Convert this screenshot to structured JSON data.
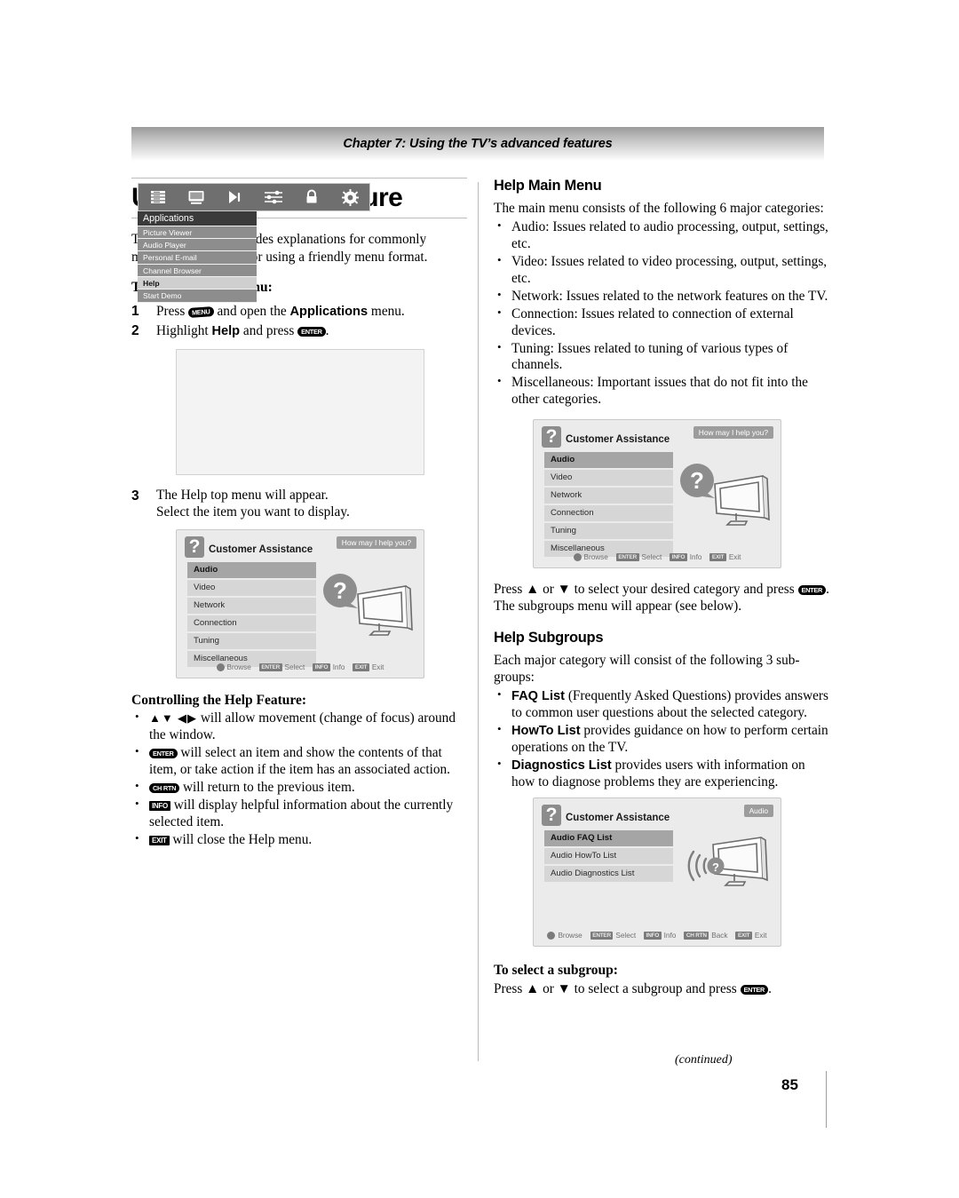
{
  "header": {
    "chapter": "Chapter 7: Using the TV’s advanced features"
  },
  "left_column": {
    "title": "Using the Help feature",
    "intro": "The Help feature provides explanations for commonly misunderstood behavior using a friendly menu format.",
    "open_help_heading": "To open the Help menu:",
    "steps": [
      {
        "num": "1",
        "before": "Press",
        "key": "MENU",
        "middle": "and open the",
        "bold": "Applications",
        "after": "menu."
      },
      {
        "num": "2",
        "before": "Highlight",
        "bold": "Help",
        "middle": "and press",
        "key": "ENTER",
        "after": "."
      },
      {
        "num": "3",
        "line1": "The Help top menu will appear.",
        "line2": "Select the item you want to display."
      }
    ],
    "apps_shot": {
      "icons": [
        "list-icon",
        "monitor-icon",
        "play-sound-icon",
        "sliders-icon",
        "lock-icon",
        "gear-icon"
      ],
      "menu_header": "Applications",
      "items": [
        {
          "label": "Picture Viewer",
          "selected": false
        },
        {
          "label": "Audio Player",
          "selected": false
        },
        {
          "label": "Personal E-mail",
          "selected": false
        },
        {
          "label": "Channel Browser",
          "selected": false
        },
        {
          "label": "Help",
          "selected": true
        },
        {
          "label": "Start Demo",
          "selected": false
        }
      ]
    },
    "ca_shot": {
      "title": "Customer Assistance",
      "pill": "How may I help you?",
      "items": [
        {
          "label": "Audio",
          "selected": true
        },
        {
          "label": "Video",
          "selected": false
        },
        {
          "label": "Network",
          "selected": false
        },
        {
          "label": "Connection",
          "selected": false
        },
        {
          "label": "Tuning",
          "selected": false
        },
        {
          "label": "Miscellaneous",
          "selected": false
        }
      ],
      "footer": [
        {
          "key": "",
          "icon": "dpad-icon",
          "label": "Browse"
        },
        {
          "key": "ENTER",
          "label": "Select"
        },
        {
          "key": "INFO",
          "label": "Info"
        },
        {
          "key": "EXIT",
          "label": "Exit"
        }
      ]
    },
    "controlling_heading": "Controlling the Help Feature:",
    "controlling_bullets": [
      {
        "glyph": "▲▼ ◀▶",
        "text": "will allow movement (change of focus) around the window."
      },
      {
        "key": "ENTER",
        "round": true,
        "text": "will select an item and show the contents of that item, or take action if the item has an associated action."
      },
      {
        "key": "CH RTN",
        "round": true,
        "text": "will return to the previous item."
      },
      {
        "key": "INFO",
        "round": false,
        "text": "will display helpful information about the currently selected item."
      },
      {
        "key": "EXIT",
        "round": false,
        "text": "will close the Help menu."
      }
    ]
  },
  "right_column": {
    "main_menu_heading": "Help Main Menu",
    "main_menu_intro": "The main menu consists of the following 6 major categories:",
    "main_menu_bullets": [
      "Audio: Issues related to audio processing, output, settings, etc.",
      "Video: Issues related to video processing, output, settings, etc.",
      "Network: Issues related to the network features on the TV.",
      "Connection: Issues related to connection of external devices.",
      "Tuning: Issues related to tuning of various types of channels.",
      "Miscellaneous: Important issues that do not fit into the other categories."
    ],
    "ca_shot": {
      "title": "Customer Assistance",
      "pill": "How may I help you?",
      "items": [
        {
          "label": "Audio",
          "selected": true
        },
        {
          "label": "Video",
          "selected": false
        },
        {
          "label": "Network",
          "selected": false
        },
        {
          "label": "Connection",
          "selected": false
        },
        {
          "label": "Tuning",
          "selected": false
        },
        {
          "label": "Miscellaneous",
          "selected": false
        }
      ],
      "footer": [
        {
          "icon": "dpad-icon",
          "label": "Browse"
        },
        {
          "key": "ENTER",
          "label": "Select"
        },
        {
          "key": "INFO",
          "label": "Info"
        },
        {
          "key": "EXIT",
          "label": "Exit"
        }
      ]
    },
    "press_para_1": "Press ▲ or ▼ to select your desired category and press",
    "press_para_1_key": "ENTER",
    "press_para_2": "The subgroups menu will appear (see below).",
    "subgroups_heading": "Help Subgroups",
    "subgroups_intro": "Each major category will consist of the following 3 sub-groups:",
    "subgroups_bullets": [
      {
        "bold": "FAQ List",
        "text": "(Frequently Asked Questions) provides answers to common user questions about the selected category."
      },
      {
        "bold": "HowTo List",
        "text": "provides guidance on how to perform certain operations on the TV."
      },
      {
        "bold": "Diagnostics List",
        "text": "provides users with information on how to diagnose problems they are experiencing."
      }
    ],
    "audio_shot": {
      "title": "Customer Assistance",
      "pill": "Audio",
      "items": [
        {
          "label": "Audio FAQ List",
          "selected": true
        },
        {
          "label": "Audio HowTo List",
          "selected": false
        },
        {
          "label": "Audio Diagnostics List",
          "selected": false
        }
      ],
      "footer": [
        {
          "icon": "dpad-icon",
          "label": "Browse"
        },
        {
          "key": "ENTER",
          "label": "Select"
        },
        {
          "key": "INFO",
          "label": "Info"
        },
        {
          "key": "CH RTN",
          "label": "Back"
        },
        {
          "key": "EXIT",
          "label": "Exit"
        }
      ]
    },
    "select_subgroup_heading": "To select a subgroup:",
    "select_subgroup_text_before": "Press ▲ or ▼ to select a subgroup and press",
    "select_subgroup_key": "ENTER",
    "select_subgroup_text_after": "."
  },
  "footer": {
    "continued": "(continued)",
    "page_number": "85"
  }
}
